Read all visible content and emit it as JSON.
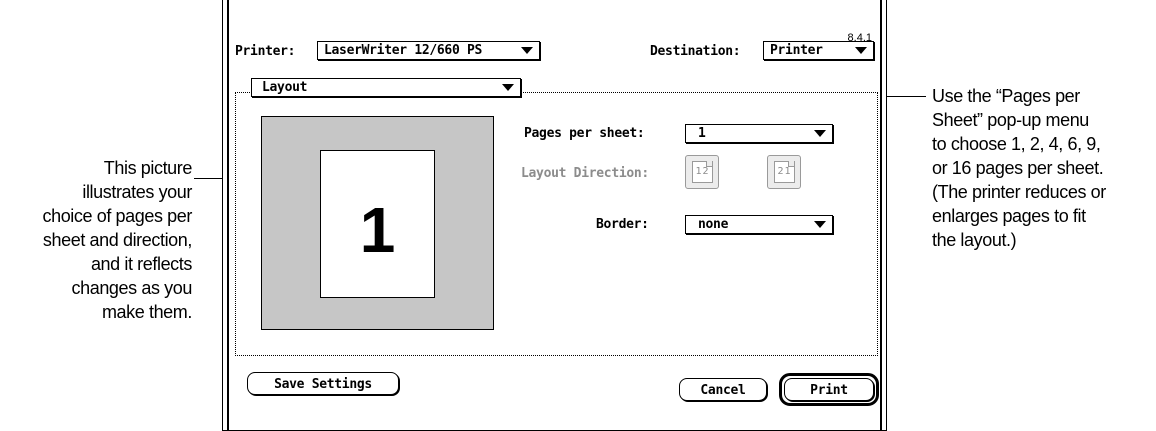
{
  "annotations": {
    "left_lines": [
      "This picture",
      "illustrates your",
      "choice of pages per",
      "sheet and direction,",
      "and it reflects",
      "changes as you",
      "make them."
    ],
    "right_lines": [
      "Use the “Pages per",
      "Sheet” pop-up menu",
      "to choose 1, 2, 4, 6, 9,",
      "or 16 pages per sheet.",
      "(The printer reduces or",
      "enlarges pages to fit",
      "the layout.)"
    ]
  },
  "dialog": {
    "version": "8.4.1",
    "printer_label": "Printer:",
    "printer_value": "LaserWriter 12/660 PS",
    "destination_label": "Destination:",
    "destination_value": "Printer",
    "panel_value": "Layout",
    "preview_page_number": "1",
    "pages_per_sheet_label": "Pages per sheet:",
    "pages_per_sheet_value": "1",
    "layout_direction_label": "Layout Direction:",
    "direction_option_1": "12",
    "direction_option_2": "21",
    "border_label": "Border:",
    "border_value": "none",
    "save_settings_label": "Save Settings",
    "cancel_label": "Cancel",
    "print_label": "Print"
  },
  "colors": {
    "preview_background": "#c6c6c6",
    "disabled_text": "#8c8c8c"
  }
}
